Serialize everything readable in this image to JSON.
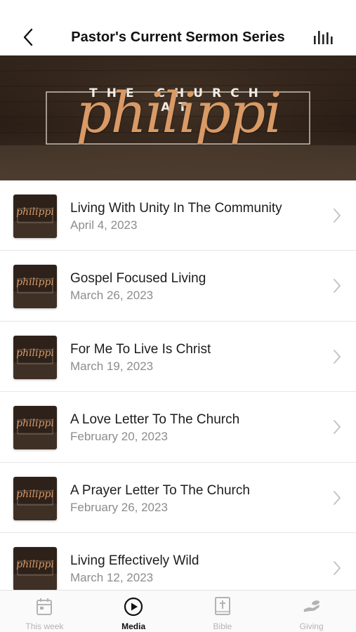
{
  "header": {
    "title": "Pastor's Current Sermon Series"
  },
  "banner": {
    "line1": "THE CHURCH AT",
    "script": "philippi"
  },
  "sermons": [
    {
      "title": "Living With Unity In The Community",
      "date": "April 4, 2023",
      "thumb_text": "philippi"
    },
    {
      "title": "Gospel Focused Living",
      "date": "March 26, 2023",
      "thumb_text": "philippi"
    },
    {
      "title": "For Me To Live Is Christ",
      "date": "March 19, 2023",
      "thumb_text": "philippi"
    },
    {
      "title": "A Love Letter To The Church",
      "date": "February 20, 2023",
      "thumb_text": "philippi"
    },
    {
      "title": "A Prayer Letter To The Church",
      "date": "February 26, 2023",
      "thumb_text": "philippi"
    },
    {
      "title": "Living Effectively Wild",
      "date": "March 12, 2023",
      "thumb_text": "philippi"
    }
  ],
  "tabs": [
    {
      "label": "This week",
      "icon": "calendar-icon",
      "active": false
    },
    {
      "label": "Media",
      "icon": "play-circle-icon",
      "active": true
    },
    {
      "label": "Bible",
      "icon": "bible-icon",
      "active": false
    },
    {
      "label": "Giving",
      "icon": "giving-hand-icon",
      "active": false
    }
  ],
  "colors": {
    "banner_bg": "#2a1e16",
    "banner_accent": "#d99a66",
    "active_tab": "#111111",
    "inactive_tab": "#b3b3b3"
  }
}
